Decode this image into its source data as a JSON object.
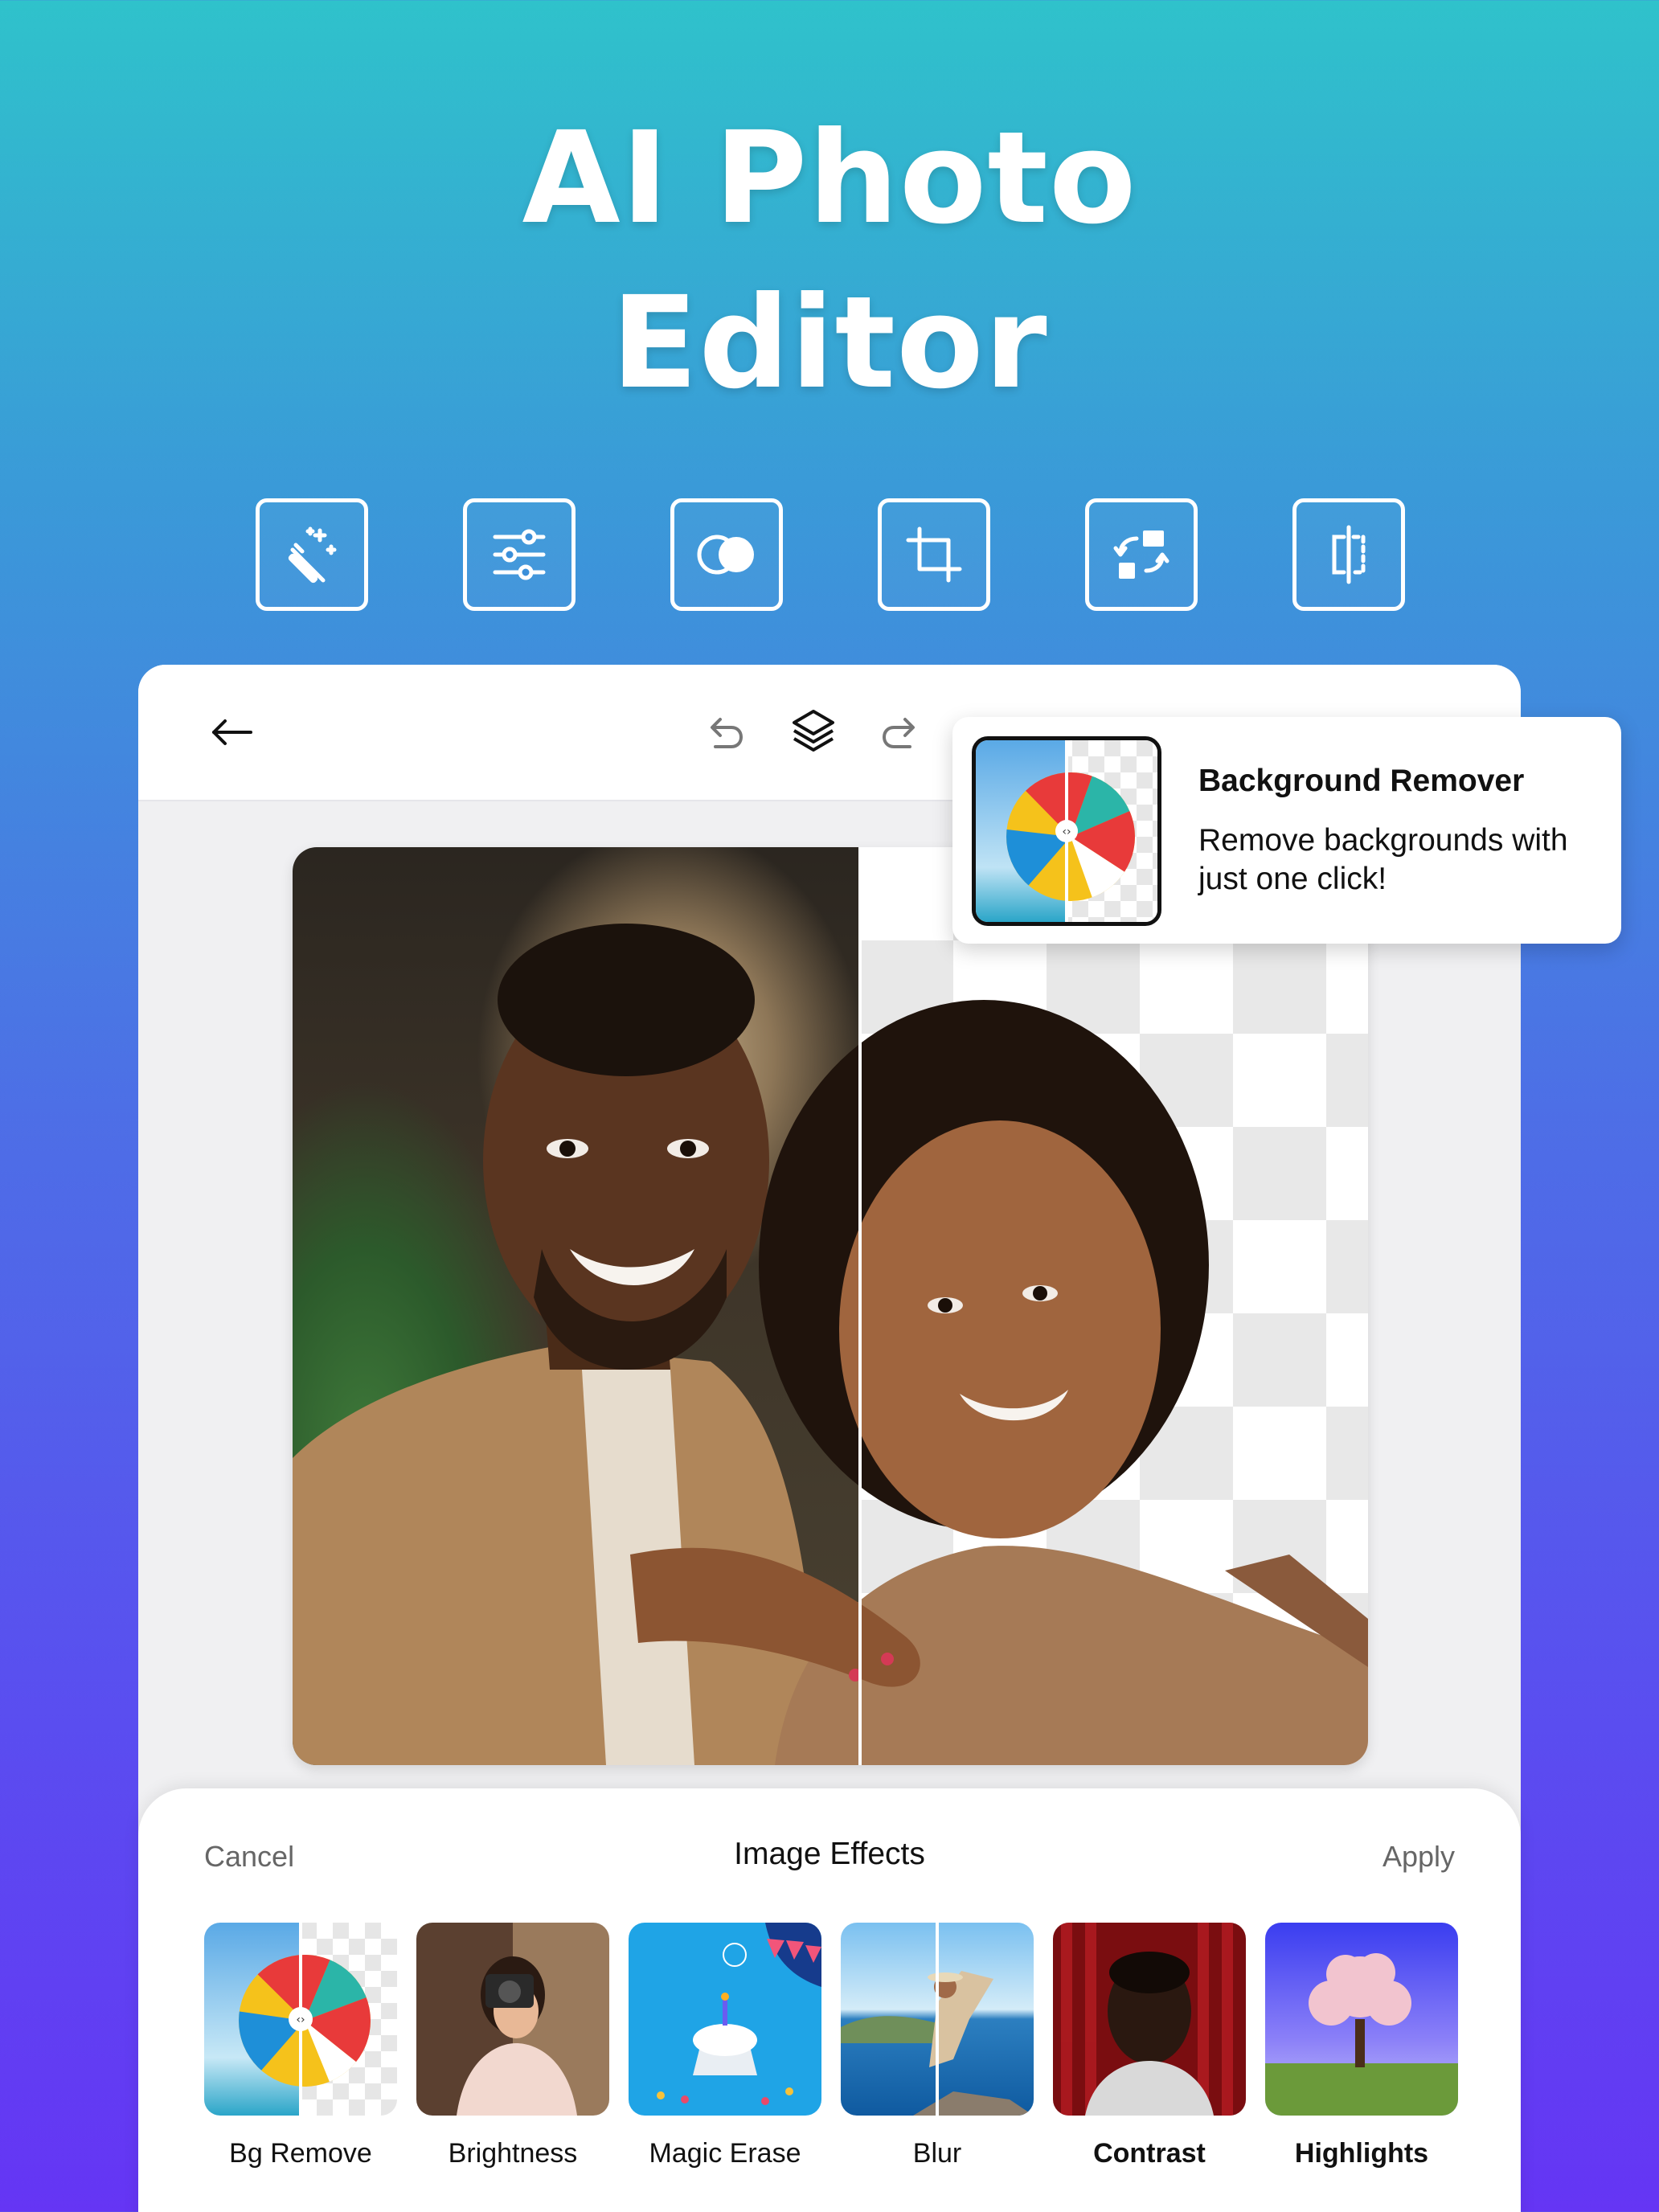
{
  "hero": {
    "title_line1": "AI Photo",
    "title_line2": "Editor"
  },
  "tools": [
    {
      "icon": "magic-wand-icon"
    },
    {
      "icon": "sliders-icon"
    },
    {
      "icon": "blend-circles-icon"
    },
    {
      "icon": "crop-icon"
    },
    {
      "icon": "swap-icon"
    },
    {
      "icon": "compare-split-icon"
    }
  ],
  "toolbar": {
    "back_icon": "arrow-left-icon",
    "undo_icon": "undo-icon",
    "layers_icon": "layers-icon",
    "redo_icon": "redo-icon"
  },
  "tooltip": {
    "title": "Background Remover",
    "description": "Remove backgrounds with just one click!"
  },
  "sheet": {
    "cancel": "Cancel",
    "title": "Image Effects",
    "apply": "Apply"
  },
  "effects": [
    {
      "label": "Bg Remove",
      "bold": false
    },
    {
      "label": "Brightness",
      "bold": false
    },
    {
      "label": "Magic Erase",
      "bold": false
    },
    {
      "label": "Blur",
      "bold": false
    },
    {
      "label": "Contrast",
      "bold": true
    },
    {
      "label": "Highlights",
      "bold": true
    }
  ],
  "colors": {
    "gradient_top": "#2fc2cb",
    "gradient_bottom": "#6535f4",
    "text_dark": "#111111"
  }
}
